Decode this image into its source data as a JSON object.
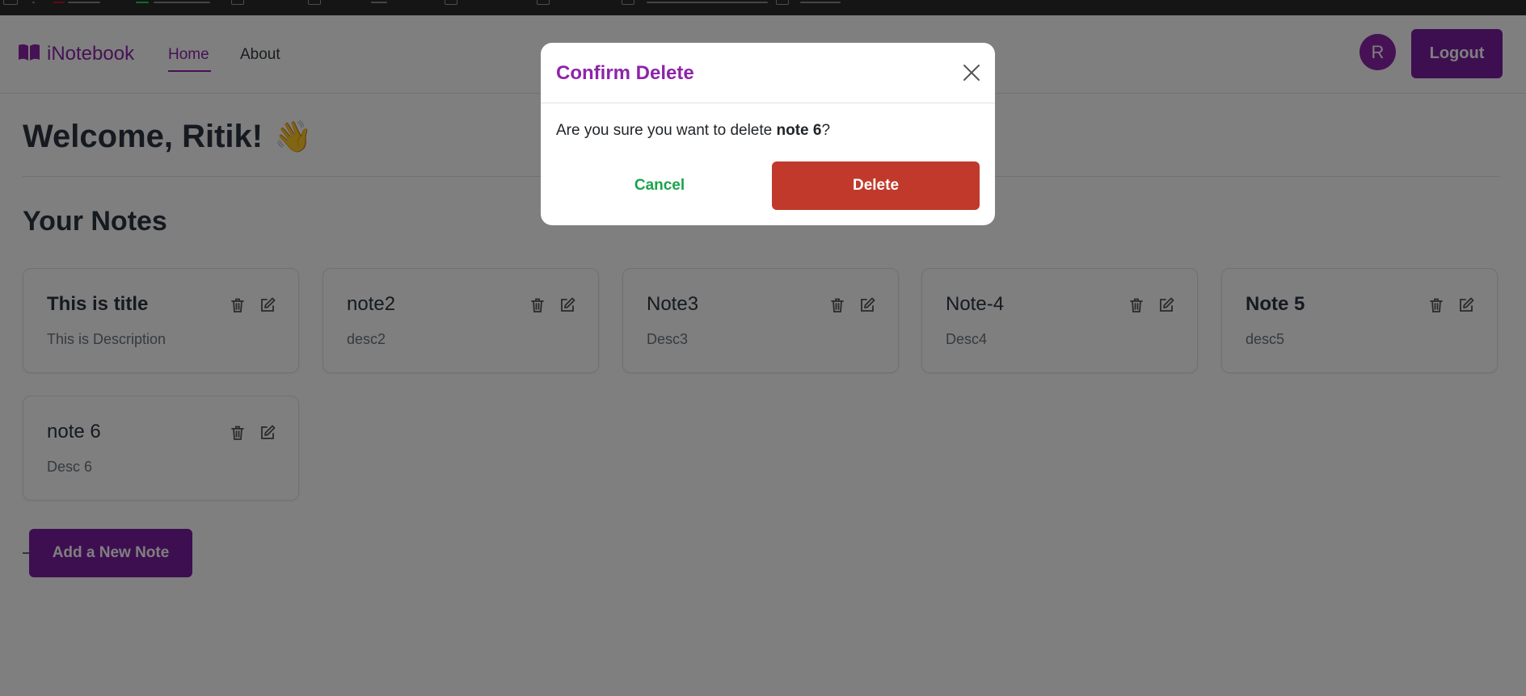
{
  "nav": {
    "brand": "iNotebook",
    "links": [
      {
        "label": "Home",
        "active": true
      },
      {
        "label": "About",
        "active": false
      }
    ],
    "avatar_initial": "R",
    "logout_label": "Logout"
  },
  "main": {
    "welcome": "Welcome, Ritik!",
    "welcome_emoji": "👋",
    "notes_heading": "Your Notes",
    "notes": [
      {
        "title": "This is title",
        "description": "This is Description"
      },
      {
        "title": "note2",
        "description": "desc2"
      },
      {
        "title": "Note3",
        "description": "Desc3"
      },
      {
        "title": "Note-4",
        "description": "Desc4"
      },
      {
        "title": "Note 5",
        "description": "desc5"
      },
      {
        "title": "note 6",
        "description": "Desc 6"
      }
    ],
    "add_button_label": "Add a New Note"
  },
  "modal": {
    "title": "Confirm Delete",
    "message_prefix": "Are you sure you want to delete ",
    "message_target": "note 6",
    "message_suffix": "?",
    "cancel_label": "Cancel",
    "delete_label": "Delete"
  },
  "colors": {
    "accent": "#8e24aa",
    "button_purple": "#7b1fa2",
    "danger": "#c0392b",
    "success": "#1aa54a"
  }
}
